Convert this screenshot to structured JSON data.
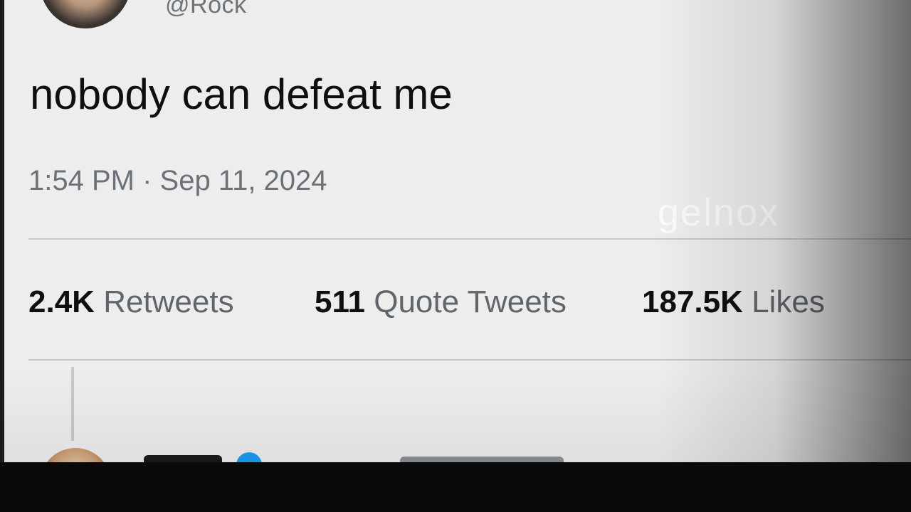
{
  "tweet": {
    "handle": "@Rock",
    "text": "nobody can defeat me",
    "timestamp": "1:54 PM · Sep 11, 2024",
    "watermark": "gelnox"
  },
  "stats": {
    "retweets": {
      "count": "2.4K",
      "label": "Retweets"
    },
    "quote_tweets": {
      "count": "511",
      "label": "Quote Tweets"
    },
    "likes": {
      "count": "187.5K",
      "label": "Likes"
    }
  },
  "colors": {
    "card_background": "#ededed",
    "primary_text": "#0f0f0f",
    "secondary_text": "#6b7177",
    "divider": "#c4c6c8",
    "verified_blue": "#1d9bf0",
    "frame": "#0a0a0a"
  },
  "icons": {
    "verified": "verified-badge-icon"
  }
}
